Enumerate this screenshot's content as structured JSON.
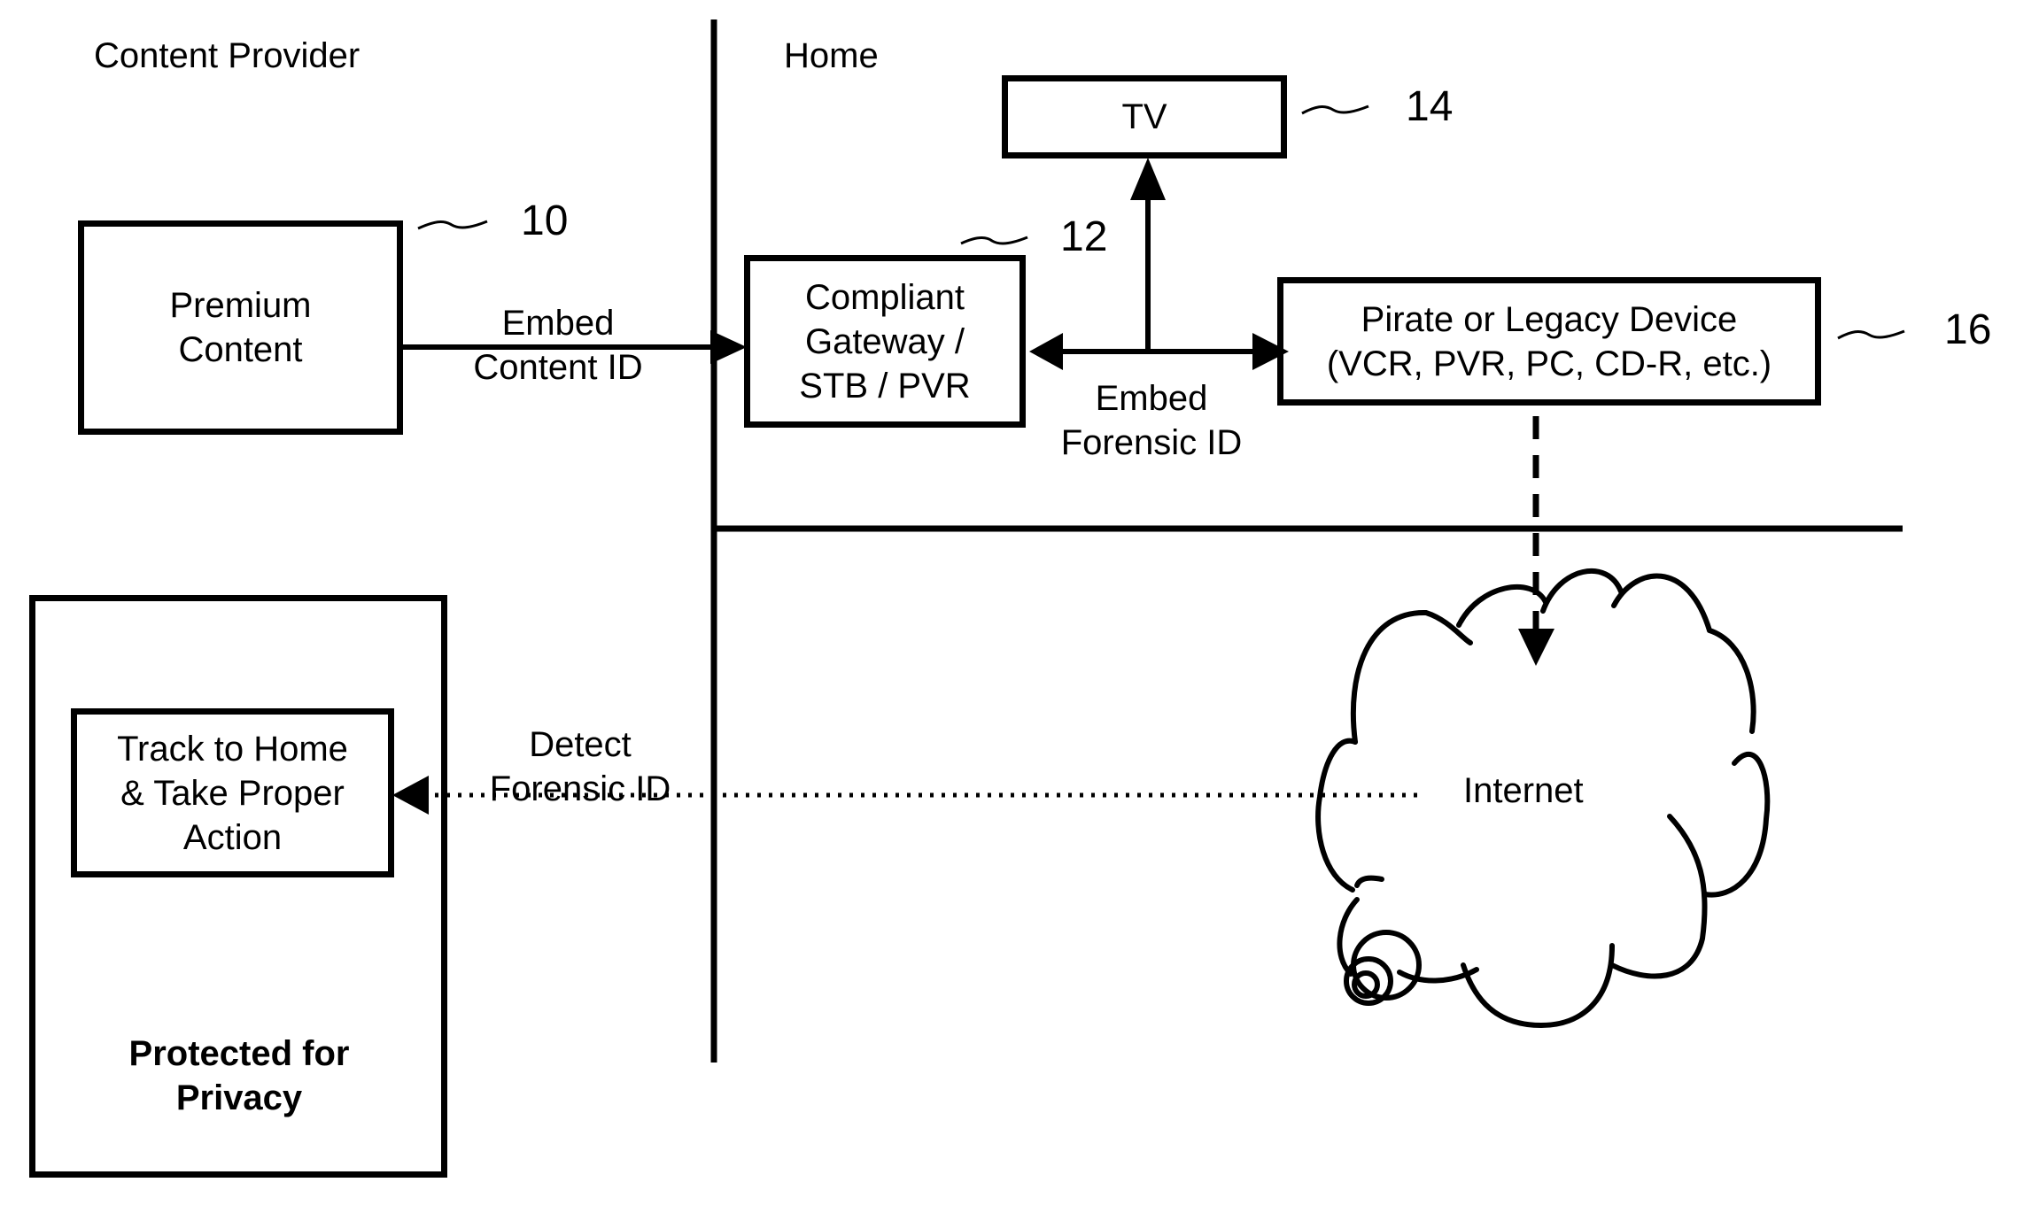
{
  "regions": {
    "content_provider": "Content Provider",
    "home": "Home"
  },
  "nodes": {
    "premium_content": {
      "lines": [
        "Premium",
        "Content"
      ],
      "ref": "10"
    },
    "gateway": {
      "lines": [
        "Compliant",
        "Gateway /",
        "STB / PVR"
      ],
      "ref": "12"
    },
    "tv": {
      "lines": [
        "TV"
      ],
      "ref": "14"
    },
    "pirate_device": {
      "lines": [
        "Pirate or Legacy Device",
        "(VCR, PVR, PC, CD-R, etc.)"
      ],
      "ref": "16"
    },
    "internet": {
      "label": "Internet"
    },
    "track": {
      "lines": [
        "Track to Home",
        "& Take Proper",
        "Action"
      ]
    },
    "privacy": {
      "lines": [
        "Protected for",
        "Privacy"
      ]
    }
  },
  "edges": {
    "embed_content_id": [
      "Embed",
      "Content ID"
    ],
    "embed_forensic_id": [
      "Embed",
      "Forensic ID"
    ],
    "detect_forensic_id": [
      "Detect",
      "Forensic ID"
    ]
  }
}
